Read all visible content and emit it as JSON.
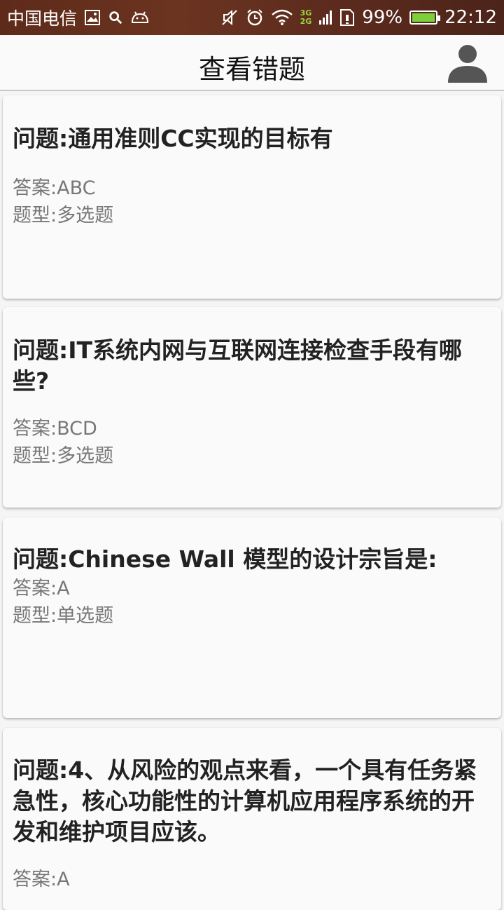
{
  "status_bar": {
    "carrier": "中国电信",
    "network_top": "3G",
    "network_bottom": "2G",
    "battery_percent": "99%",
    "battery_level": 0.99,
    "time": "22:12",
    "icons": [
      "image-icon",
      "search-icon",
      "android-icon",
      "mute-icon",
      "alarm-icon",
      "wifi-icon",
      "signal-icon",
      "sim-icon",
      "battery-icon"
    ]
  },
  "app_bar": {
    "title": "查看错题",
    "user_icon": "person-icon"
  },
  "questions": [
    {
      "question": "问题:通用准则CC实现的目标有",
      "answer": "答案:ABC",
      "type": "题型:多选题"
    },
    {
      "question": "问题:IT系统内网与互联网连接检查手段有哪些?",
      "answer": "答案:BCD",
      "type": "题型:多选题"
    },
    {
      "question": "问题:Chinese Wall 模型的设计宗旨是:",
      "answer": "答案:A",
      "type": "题型:单选题"
    },
    {
      "question": "问题:4、从风险的观点来看，一个具有任务紧急性，核心功能性的计算机应用程序系统的开发和维护项目应该。",
      "answer": "答案:A",
      "type": ""
    }
  ],
  "colors": {
    "status_bar": "#5e2a1a",
    "app_bar": "#fafafa",
    "background": "#f5f5f5",
    "network_badge": "#9ad43a"
  }
}
